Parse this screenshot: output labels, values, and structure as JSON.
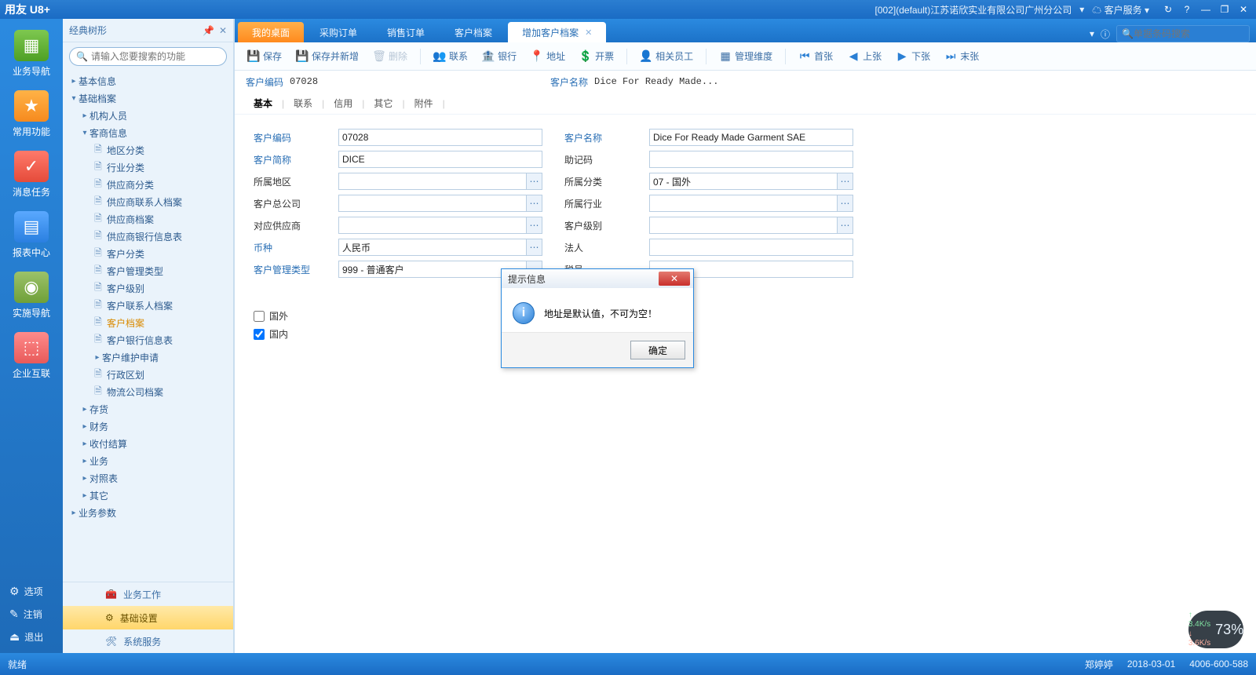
{
  "titlebar": {
    "logo": "用友 U8+",
    "company": "[002](default)江苏诺欣实业有限公司广州分公司",
    "service": "客户服务"
  },
  "iconbar": {
    "items": [
      {
        "label": "业务导航"
      },
      {
        "label": "常用功能"
      },
      {
        "label": "消息任务"
      },
      {
        "label": "报表中心"
      },
      {
        "label": "实施导航"
      },
      {
        "label": "企业互联"
      }
    ],
    "footer": {
      "options": "选项",
      "logout": "注销",
      "exit": "退出"
    }
  },
  "tree": {
    "title": "经典树形",
    "search_ph": "请输入您要搜索的功能",
    "n_basicinfo": "基本信息",
    "n_basearchive": "基础档案",
    "n_org": "机构人员",
    "n_partner": "客商信息",
    "leaves": {
      "area": "地区分类",
      "industry": "行业分类",
      "supcat": "供应商分类",
      "supcontact": "供应商联系人档案",
      "suparch": "供应商档案",
      "supbank": "供应商银行信息表",
      "custcat": "客户分类",
      "custmgmt": "客户管理类型",
      "custlvl": "客户级别",
      "custcontact": "客户联系人档案",
      "custarch": "客户档案",
      "custbank": "客户银行信息表",
      "custmaint": "客户维护申请",
      "admindiv": "行政区划",
      "logistics": "物流公司档案"
    },
    "n_stock": "存货",
    "n_finance": "财务",
    "n_receipt": "收付结算",
    "n_biz": "业务",
    "n_compare": "对照表",
    "n_other": "其它",
    "n_bizparam": "业务参数",
    "footer": {
      "work": "业务工作",
      "base": "基础设置",
      "sys": "系统服务"
    }
  },
  "tabs": {
    "items": [
      {
        "label": "我的桌面"
      },
      {
        "label": "采购订单"
      },
      {
        "label": "销售订单"
      },
      {
        "label": "客户档案"
      },
      {
        "label": "增加客户档案"
      }
    ],
    "search_ph": "单据条码搜索"
  },
  "toolbar": {
    "save": "保存",
    "saveadd": "保存并新增",
    "delete": "删除",
    "contact": "联系",
    "bank": "银行",
    "address": "地址",
    "invoice": "开票",
    "staff": "相关员工",
    "mgmtdim": "管理维度",
    "first": "首张",
    "prev": "上张",
    "next": "下张",
    "last": "末张"
  },
  "header": {
    "code_lbl": "客户编码",
    "code_val": "07028",
    "name_lbl": "客户名称",
    "name_val": "Dice For Ready Made..."
  },
  "subtabs": {
    "basic": "基本",
    "contact": "联系",
    "credit": "信用",
    "other": "其它",
    "attach": "附件"
  },
  "form": {
    "code_lbl": "客户编码",
    "code_val": "07028",
    "name_lbl": "客户名称",
    "name_val": "Dice For Ready Made Garment SAE",
    "short_lbl": "客户简称",
    "short_val": "DICE",
    "mnemonic_lbl": "助记码",
    "mnemonic_val": "",
    "region_lbl": "所属地区",
    "region_val": "",
    "category_lbl": "所属分类",
    "category_val": "07 - 国外",
    "hq_lbl": "客户总公司",
    "hq_val": "",
    "trade_lbl": "所属行业",
    "trade_val": "",
    "supplier_lbl": "对应供应商",
    "supplier_val": "",
    "level_lbl": "客户级别",
    "level_val": "",
    "currency_lbl": "币种",
    "currency_val": "人民币",
    "legal_lbl": "法人",
    "legal_val": "",
    "mgmt_lbl": "客户管理类型",
    "mgmt_val": "999 - 普通客户",
    "tax_lbl": "税号",
    "tax_val": "",
    "chk_foreign": "国外",
    "chk_domestic": "国内"
  },
  "modal": {
    "title": "提示信息",
    "message": "地址是默认值，不可为空！",
    "ok": "确定"
  },
  "status": {
    "ready": "就绪",
    "user": "郑婷婷",
    "date": "2018-03-01",
    "phone": "4006-600-588"
  },
  "net": {
    "up": "3.4K/s",
    "dn": "3.6K/s",
    "pct": "73%"
  }
}
